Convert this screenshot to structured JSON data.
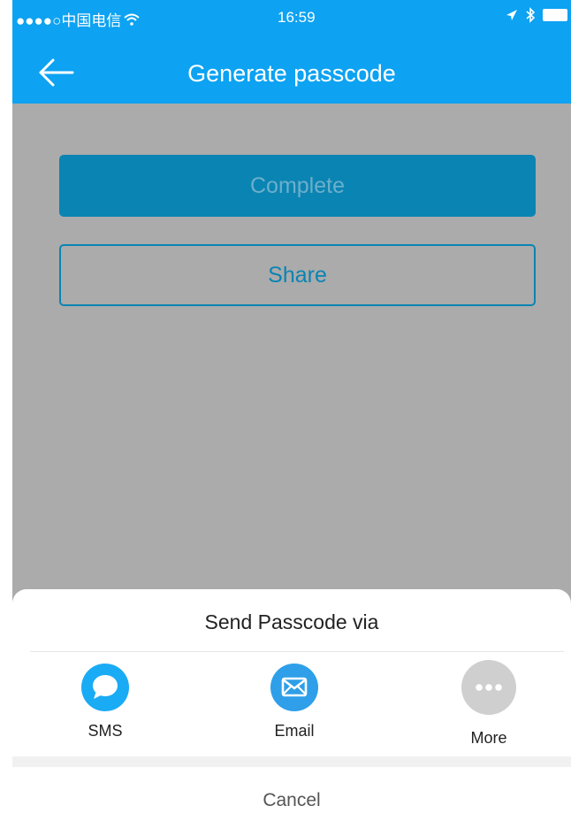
{
  "status": {
    "carrier": "●●●●○中国电信",
    "time": "16:59"
  },
  "nav": {
    "title": "Generate passcode"
  },
  "buttons": {
    "complete": "Complete",
    "share": "Share"
  },
  "sheet": {
    "title": "Send Passcode via",
    "options": [
      {
        "label": "SMS",
        "icon": "sms-icon",
        "color": "#1aabf5"
      },
      {
        "label": "Email",
        "icon": "email-icon",
        "color": "#2e9fe8"
      },
      {
        "label": "More",
        "icon": "more-icon",
        "color": "#cfcfcf"
      }
    ],
    "cancel": "Cancel"
  },
  "colors": {
    "accent": "#0da2f2",
    "button": "#0a84b3",
    "overlay": "#ababab"
  }
}
